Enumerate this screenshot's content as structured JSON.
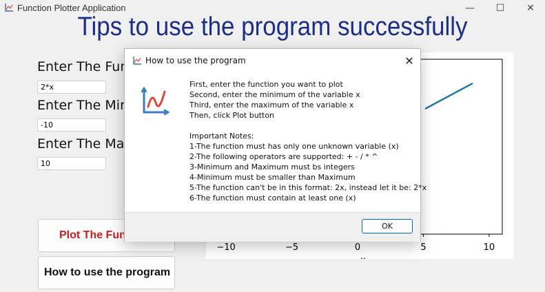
{
  "window": {
    "title": "Function Plotter Application",
    "minimize_glyph": "—",
    "maximize_glyph": "☐",
    "close_glyph": "✕"
  },
  "heading": "Tips to use the program successfully",
  "form": {
    "function_label": "Enter The Fun",
    "function_value": "2*x",
    "min_label": "Enter The Min",
    "min_value": "-10",
    "max_label": "Enter The Max",
    "max_value": "10"
  },
  "buttons": {
    "plot_label": "Plot The Fun",
    "help_label": "How to use the program"
  },
  "plot": {
    "x_ticks": [
      "−10",
      "−5",
      "0",
      "5",
      "10"
    ],
    "x_tick_values": [
      -10,
      -5,
      0,
      5,
      10
    ],
    "x_range": [
      -11,
      11
    ],
    "xlabel_partial": "x",
    "line_color": "#1f77b4"
  },
  "dialog": {
    "title": "How to use the program",
    "close_glyph": "✕",
    "lines": [
      "First, enter the function you want to plot",
      "Second, enter the minimum of the variable x",
      "Third, enter the maximum of the variable x",
      "Then, click Plot button",
      "",
      "Important Notes:",
      "1-The function must has only one unknown variable (x)",
      "2-The following operators are supported: + - / * ^",
      "3-Minimum and Maximum must bs integers",
      "4-Minimum must be smaller than Maximum",
      "5-The function can't be in this format: 2x, instead let it be: 2*x",
      "6-The function must contain at least one (x)"
    ],
    "ok_label": "OK"
  },
  "colors": {
    "heading": "#1a2f8a",
    "plot_button_text": "#d11a1a",
    "ok_border": "#0067c0"
  }
}
